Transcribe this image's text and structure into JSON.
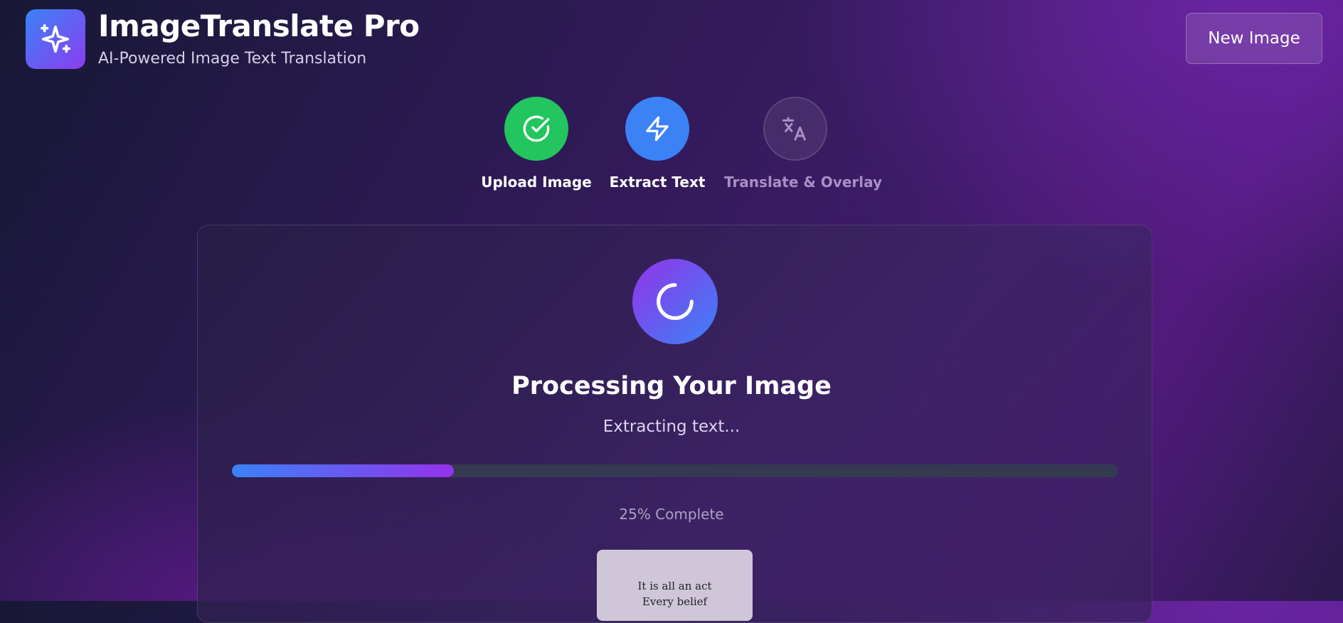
{
  "header": {
    "logo_icon": "sparkles-icon",
    "title": "ImageTranslate Pro",
    "subtitle": "AI-Powered Image Text Translation",
    "new_image_label": "New Image"
  },
  "steps": [
    {
      "label": "Upload Image",
      "icon": "check-circle-icon",
      "state": "complete",
      "color": "#22c55e"
    },
    {
      "label": "Extract Text",
      "icon": "lightning-icon",
      "state": "active",
      "color": "#3b82f6"
    },
    {
      "label": "Translate & Overlay",
      "icon": "translate-icon",
      "state": "pending"
    }
  ],
  "processing": {
    "icon": "loading-spinner-icon",
    "title": "Processing Your Image",
    "status": "Extracting text...",
    "progress_fraction": 0.25,
    "progress_label": "25% Complete"
  },
  "preview": {
    "line1": "It is all an act",
    "line2": "Every belief"
  },
  "colors": {
    "accent_blue": "#3b82f6",
    "accent_purple": "#9333ea",
    "success": "#22c55e"
  }
}
